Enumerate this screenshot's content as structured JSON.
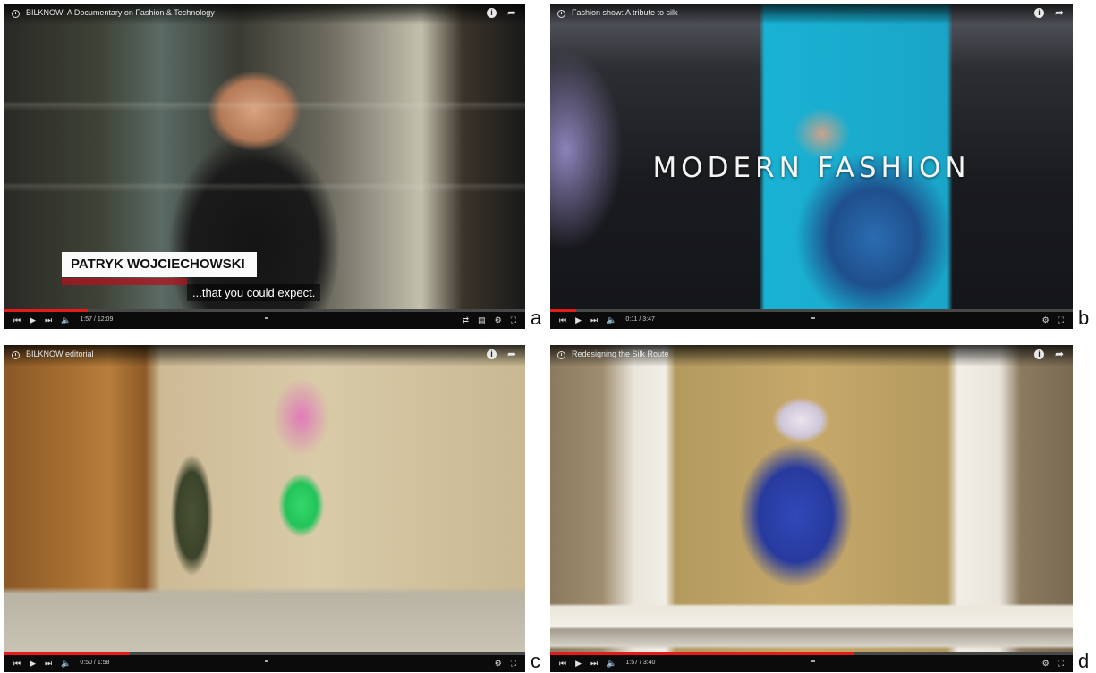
{
  "panels": [
    {
      "letter": "a",
      "video_title": "BILKNOW: A Documentary on Fashion & Technology",
      "name_card": "PATRYK WOJCIECHOWSKI",
      "subtitle": "...that you could expect.",
      "time": "1:57 / 12:09",
      "progress": 0.16
    },
    {
      "letter": "b",
      "video_title": "Fashion show: A tribute to silk",
      "overlay_text": "MODERN FASHION",
      "time": "0:11 / 3:47",
      "progress": 0.05
    },
    {
      "letter": "c",
      "video_title": "BILKNOW editorial",
      "time": "0:50 / 1:58",
      "progress": 0.24
    },
    {
      "letter": "d",
      "video_title": "Redesigning the Silk Route",
      "time": "1:57 / 3:40",
      "progress": 0.58
    }
  ],
  "icons": {
    "clock": "clock-icon",
    "info": "info-icon",
    "share": "share-icon",
    "skip_back": "skip-back-icon",
    "play": "play-icon",
    "skip_next": "skip-next-icon",
    "volume": "volume-icon",
    "settings": "settings-icon",
    "fullscreen": "fullscreen-icon"
  },
  "colors": {
    "progress": "#e31b1b",
    "bar": "#0b0b0b"
  }
}
